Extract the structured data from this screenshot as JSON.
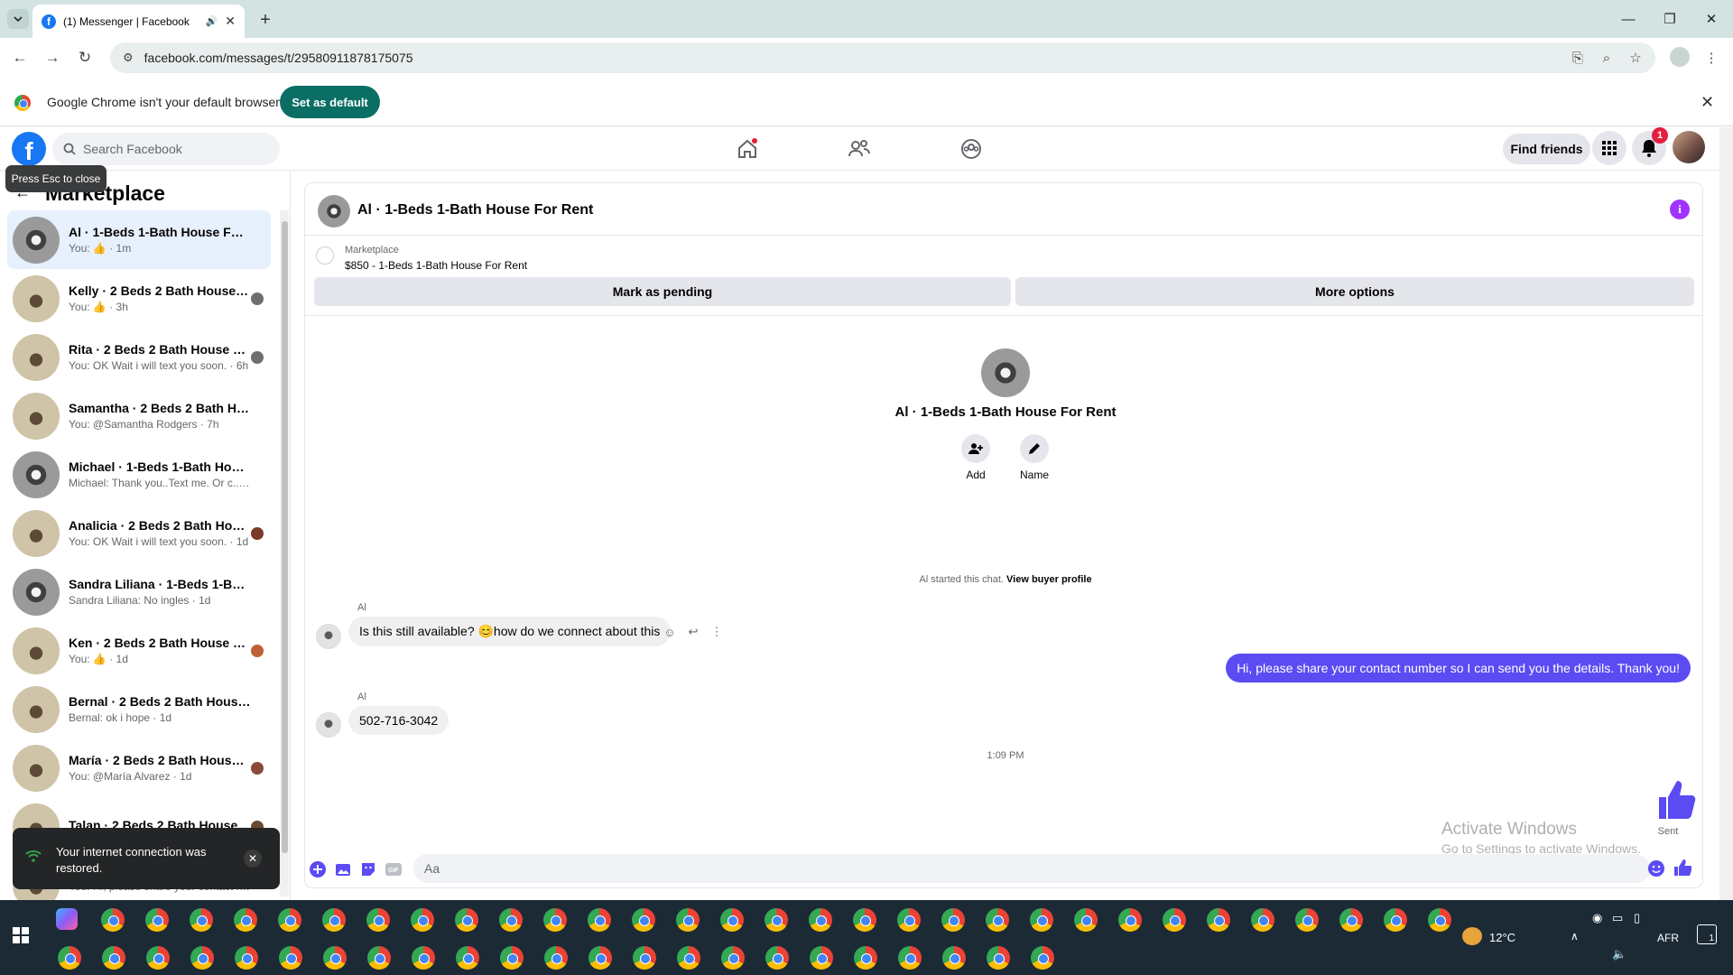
{
  "browser": {
    "tab_title": "(1) Messenger | Facebook",
    "url": "facebook.com/messages/t/29580911878175075",
    "infobar_text": "Google Chrome isn't your default browser",
    "set_default_label": "Set as default"
  },
  "fb_nav": {
    "search_placeholder": "Search Facebook",
    "find_friends_label": "Find friends",
    "notification_count": "1",
    "tooltip": "Press Esc to close"
  },
  "sidebar": {
    "title": "Marketplace",
    "conversations": [
      {
        "name": "Al · 1-Beds 1-Bath House For Rent",
        "preview": "You: 👍 · 1m",
        "active": true
      },
      {
        "name": "Kelly · 2 Beds 2 Bath House F...",
        "preview": "You: 👍 · 3h"
      },
      {
        "name": "Rita · 2 Beds 2 Bath House Fo...",
        "preview": "You: OK Wait i will text you soon. · 6h"
      },
      {
        "name": "Samantha · 2 Beds 2 Bath Hous...",
        "preview": "You: @Samantha Rodgers · 7h"
      },
      {
        "name": "Michael · 1-Beds 1-Bath House F...",
        "preview": "Michael: Thank you..Text me. Or c... · 23h"
      },
      {
        "name": "Analicia · 2 Beds 2 Bath Hous...",
        "preview": "You: OK Wait i will text you soon. · 1d"
      },
      {
        "name": "Sandra Liliana · 1-Beds 1-Bath H...",
        "preview": "Sandra Liliana: No ingles · 1d"
      },
      {
        "name": "Ken · 2 Beds 2 Bath House Fo...",
        "preview": "You: 👍 · 1d"
      },
      {
        "name": "Bernal · 2 Beds 2 Bath House Fo...",
        "preview": "Bernal: ok i hope · 1d"
      },
      {
        "name": "María · 2 Beds 2 Bath House ...",
        "preview": "You: @María Alvarez · 1d"
      },
      {
        "name": "Talan · 2 Beds 2 Bath House F...",
        "preview": ""
      },
      {
        "name": "",
        "preview": "You: Hi, please share your contact ... · 3d"
      }
    ]
  },
  "toast": {
    "message": "Your internet connection was restored."
  },
  "chat": {
    "title": "Al · 1-Beds 1-Bath House For Rent",
    "marketplace_label": "Marketplace",
    "listing": "$850 - 1-Beds 1-Bath House For Rent",
    "mark_pending_label": "Mark as pending",
    "more_options_label": "More options",
    "profile_title": "Al · 1-Beds 1-Bath House For Rent",
    "add_label": "Add",
    "name_label": "Name",
    "started_text": "Al started this chat.",
    "view_buyer_profile": "View buyer profile",
    "messages": [
      {
        "sender": "Al",
        "text": "Is this still available? 😊how do we connect about this",
        "direction": "in"
      },
      {
        "sender": "",
        "text": "Hi, please share your contact number so I can send you the details. Thank you!",
        "direction": "out"
      },
      {
        "sender": "Al",
        "text": "502-716-3042",
        "direction": "in"
      }
    ],
    "timestamp": "1:09 PM",
    "sent_label": "Sent",
    "composer_placeholder": "Aa"
  },
  "watermark": {
    "line1": "Activate Windows",
    "line2": "Go to Settings to activate Windows."
  },
  "taskbar": {
    "weather": "12°C",
    "language": "AFR",
    "notification_count": "1"
  },
  "colors": {
    "fb_blue": "#1877f2",
    "outgoing_bubble": "#5b4bf3",
    "set_default_button": "#0b6e64",
    "info_icon": "#a033ff"
  }
}
